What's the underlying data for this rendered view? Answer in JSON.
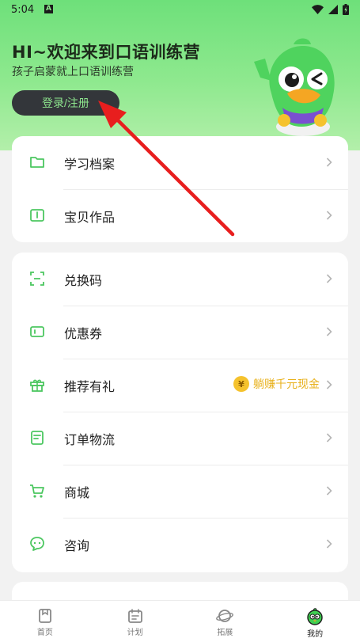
{
  "status_bar": {
    "time": "5:04",
    "notification_letter": "A"
  },
  "hero": {
    "title": "HI~欢迎来到口语训练营",
    "subtitle": "孩子启蒙就上口语训练营",
    "login_label": "登录/注册"
  },
  "menu_group_1": [
    {
      "label": "学习档案",
      "icon": "folder-icon"
    },
    {
      "label": "宝贝作品",
      "icon": "book-icon"
    }
  ],
  "menu_group_2": [
    {
      "label": "兑换码",
      "icon": "scan-code-icon"
    },
    {
      "label": "优惠券",
      "icon": "coupon-icon"
    },
    {
      "label": "推荐有礼",
      "icon": "gift-icon",
      "promo": "躺赚千元现金",
      "promo_coin": "¥"
    },
    {
      "label": "订单物流",
      "icon": "order-icon"
    },
    {
      "label": "商城",
      "icon": "cart-icon"
    },
    {
      "label": "咨询",
      "icon": "chat-icon"
    }
  ],
  "tabbar": [
    {
      "label": "首页",
      "icon": "home-icon"
    },
    {
      "label": "计划",
      "icon": "calendar-icon"
    },
    {
      "label": "拓展",
      "icon": "planet-icon"
    },
    {
      "label": "我的",
      "icon": "mascot-profile-icon",
      "active": true
    }
  ],
  "colors": {
    "accent": "#6ee07a",
    "icon_green": "#4cc760",
    "promo_gold": "#e8b11c",
    "login_button": "#33363a",
    "annotation_arrow": "#e81e1e"
  }
}
